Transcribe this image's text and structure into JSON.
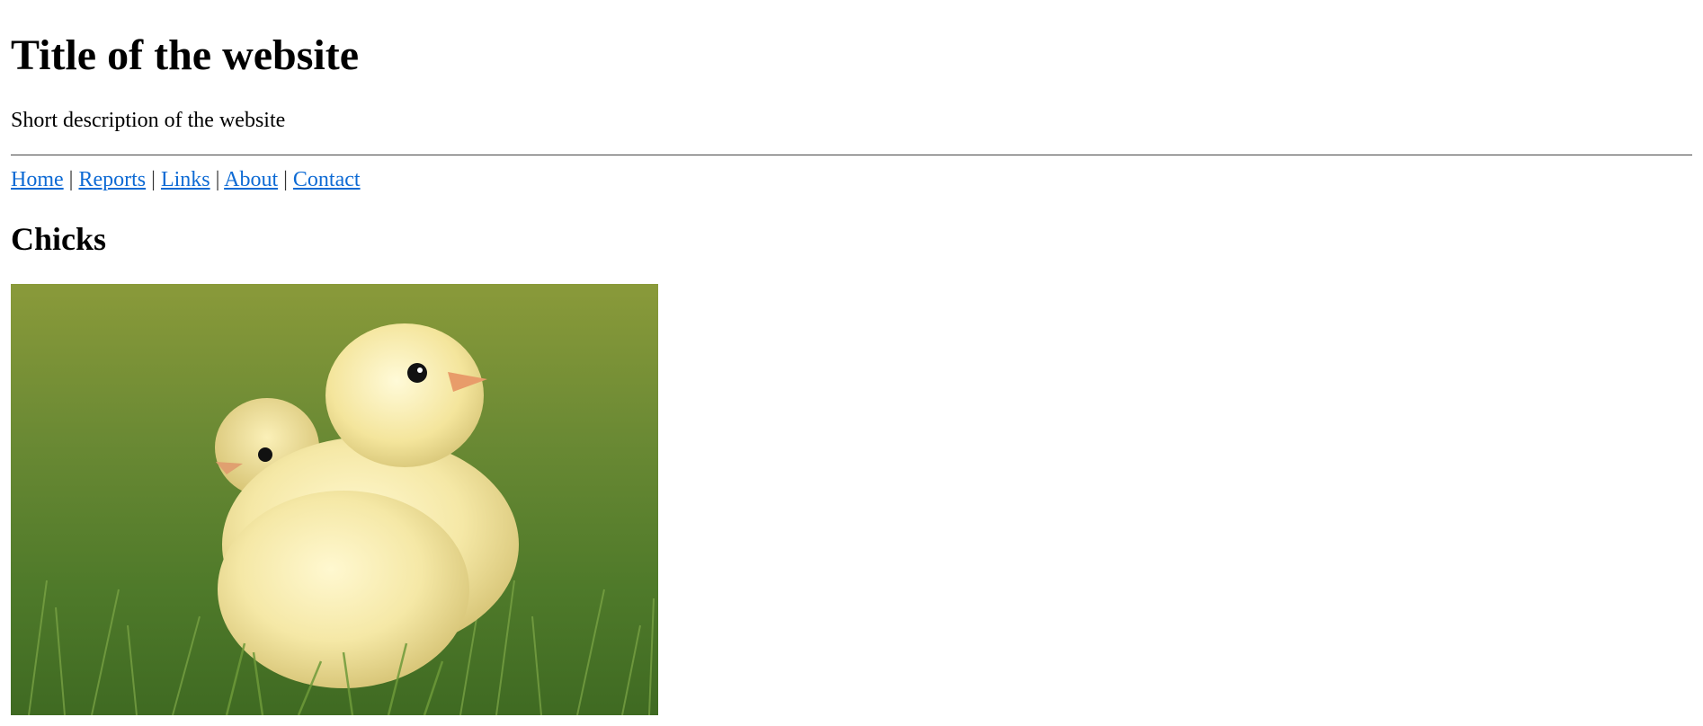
{
  "header": {
    "title": "Title of the website",
    "description": "Short description of the website"
  },
  "nav": {
    "separator": "|",
    "items": [
      {
        "label": "Home"
      },
      {
        "label": "Reports"
      },
      {
        "label": "Links"
      },
      {
        "label": "About"
      },
      {
        "label": "Contact"
      }
    ]
  },
  "main": {
    "heading": "Chicks",
    "image": {
      "subject": "two yellow chicks on grass"
    }
  },
  "colors": {
    "link": "#0d6ad4",
    "text": "#000000",
    "divider": "#444444",
    "background": "#ffffff"
  }
}
